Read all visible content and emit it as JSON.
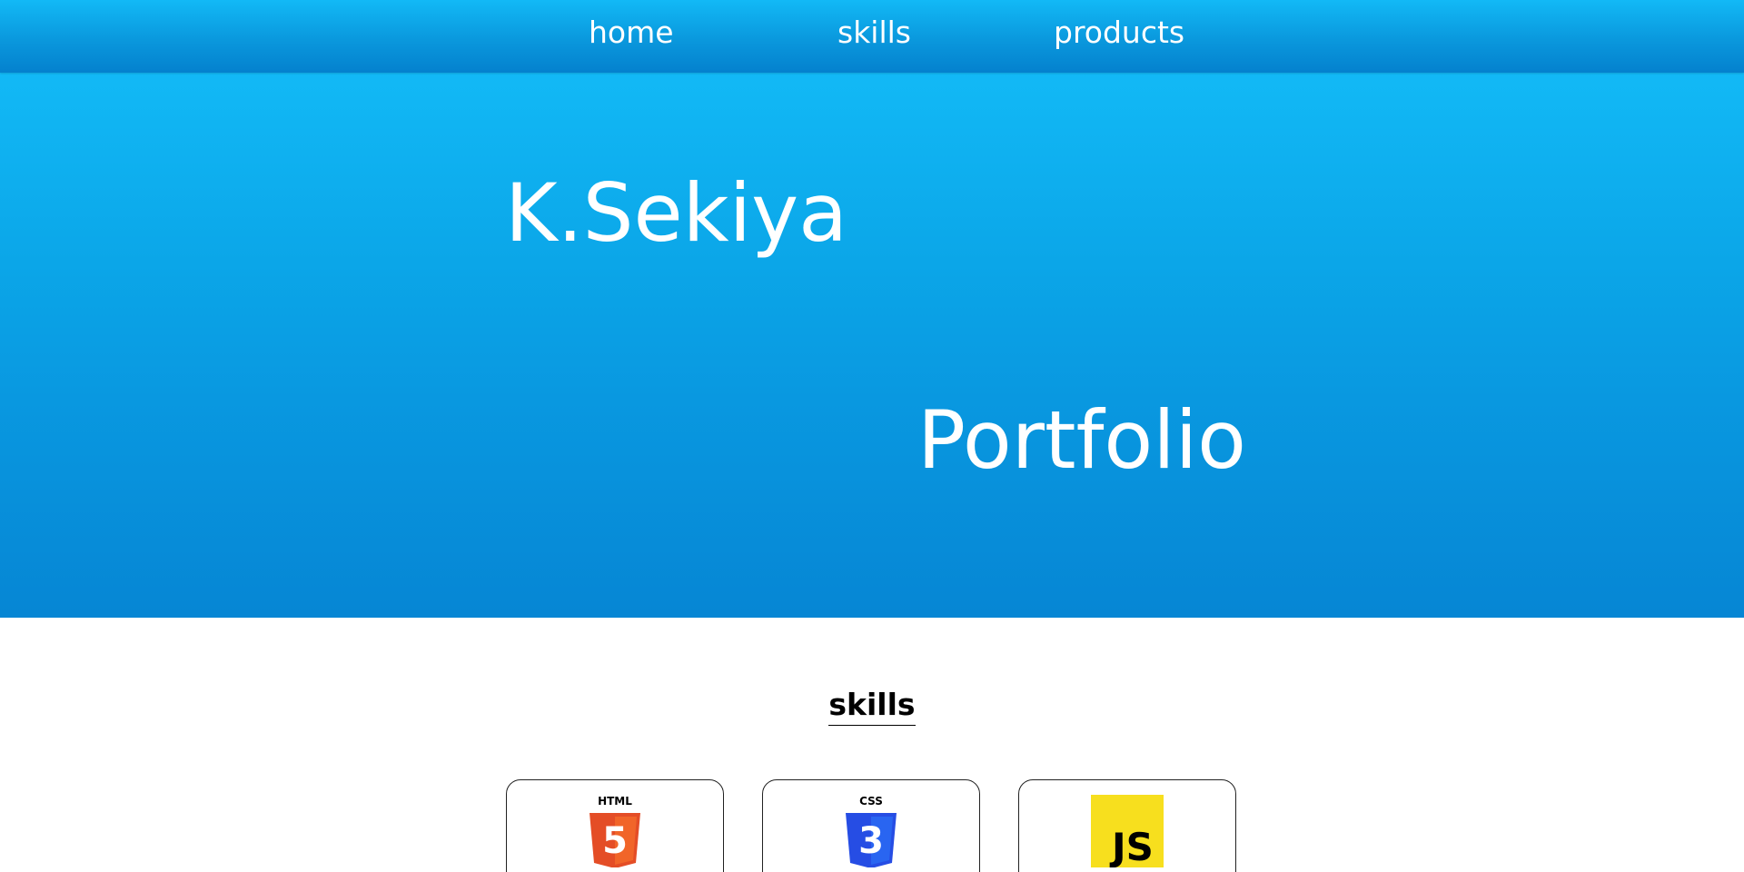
{
  "nav": {
    "items": [
      {
        "label": "home"
      },
      {
        "label": "skills"
      },
      {
        "label": "products"
      }
    ]
  },
  "hero": {
    "name": "K.Sekiya",
    "subtitle": "Portfolio"
  },
  "skills_section": {
    "title": "skills",
    "cards": [
      {
        "logo_label": "HTML",
        "logo_glyph": "5",
        "icon": "html5-icon",
        "color": "#e44d26"
      },
      {
        "logo_label": "CSS",
        "logo_glyph": "3",
        "icon": "css3-icon",
        "color": "#264de4"
      },
      {
        "logo_label": "JS",
        "icon": "javascript-icon",
        "color": "#f7df1e"
      }
    ]
  },
  "colors": {
    "nav_top": "#12b9f6",
    "nav_bottom": "#0481ce",
    "hero_top": "#12b9f6",
    "hero_bottom": "#0686d4",
    "text_on_hero": "#ffffff"
  }
}
